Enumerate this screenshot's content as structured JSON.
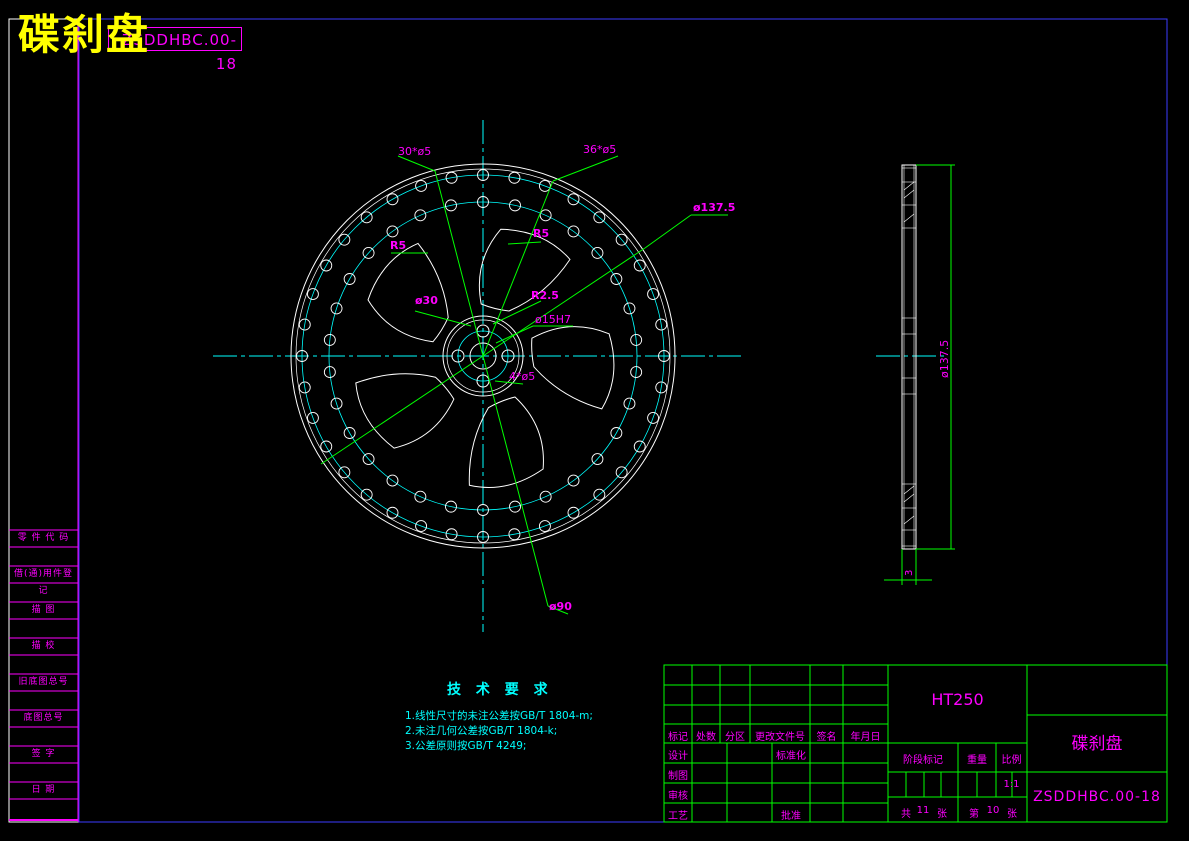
{
  "title": "碟刹盘",
  "top_code": "ZSDDHBC.00-18",
  "left_column": [
    "零 件 代 码",
    "借(通)用件登记",
    "描 图",
    "描 校",
    "旧底图总号",
    "底图总号",
    "签 字",
    "日 期"
  ],
  "dimensions": {
    "holes_inner": "30*ø5",
    "holes_outer": "36*ø5",
    "outer_dia": "ø137.5",
    "r5_left": "R5",
    "r5_right": "R5",
    "hub_dia": "ø30",
    "hub_radius": "R2.5",
    "bore": "ø15H7",
    "bolt_holes": "4*ø5",
    "bolt_circle": "ø90",
    "side_dia": "ø137.5",
    "thickness": "3"
  },
  "tech_requirements": {
    "title": "技 术 要 求",
    "lines": [
      "1.线性尺寸的未注公差按GB/T 1804-m;",
      "2.未注几何公差按GB/T 1804-k;",
      "3.公差原则按GB/T 4249;"
    ]
  },
  "title_block": {
    "material": "HT250",
    "part_name": "碟刹盘",
    "drawing_no": "ZSDDHBC.00-18",
    "header_labels": [
      "标记",
      "处数",
      "分区",
      "更改文件号",
      "签名",
      "年月日"
    ],
    "design": "设计",
    "standardization": "标准化",
    "draw": "制图",
    "review": "审核",
    "process": "工艺",
    "approve": "批准",
    "stage_mark": "阶段标记",
    "weight": "重量",
    "scale": "比例",
    "scale_value": "1:1",
    "total_label": "共",
    "total_sheets": "11",
    "sheet_label": "张",
    "sheet_no_label": "第",
    "sheet_no": "10",
    "sheet_label2": "张"
  }
}
